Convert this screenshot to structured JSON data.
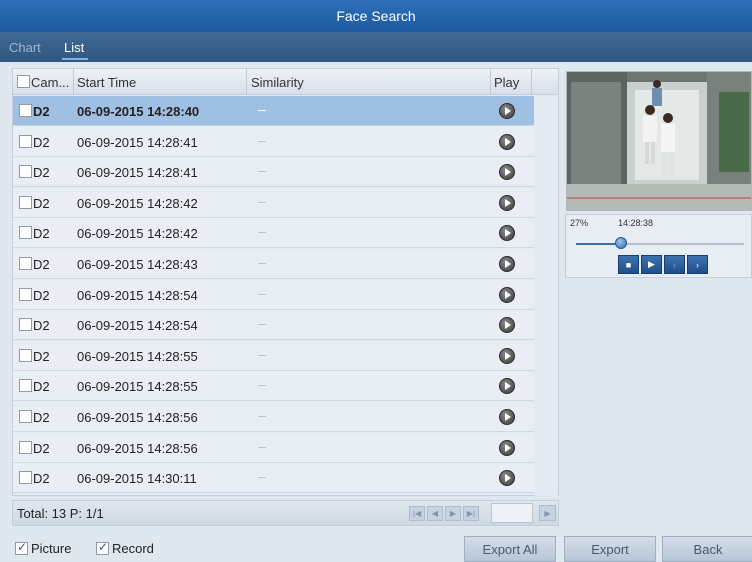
{
  "window": {
    "title": "Face Search"
  },
  "tabs": [
    {
      "label": "Chart",
      "active": false
    },
    {
      "label": "List",
      "active": true
    }
  ],
  "table": {
    "headers": {
      "camera": "Cam...",
      "start_time": "Start Time",
      "similarity": "Similarity",
      "play": "Play"
    },
    "rows": [
      {
        "camera": "D2",
        "start_time": "06-09-2015 14:28:40",
        "similarity": "—",
        "selected": true
      },
      {
        "camera": "D2",
        "start_time": "06-09-2015 14:28:41",
        "similarity": "—"
      },
      {
        "camera": "D2",
        "start_time": "06-09-2015 14:28:41",
        "similarity": "—"
      },
      {
        "camera": "D2",
        "start_time": "06-09-2015 14:28:42",
        "similarity": "—"
      },
      {
        "camera": "D2",
        "start_time": "06-09-2015 14:28:42",
        "similarity": "—"
      },
      {
        "camera": "D2",
        "start_time": "06-09-2015 14:28:43",
        "similarity": "—"
      },
      {
        "camera": "D2",
        "start_time": "06-09-2015 14:28:54",
        "similarity": "—"
      },
      {
        "camera": "D2",
        "start_time": "06-09-2015 14:28:54",
        "similarity": "—"
      },
      {
        "camera": "D2",
        "start_time": "06-09-2015 14:28:55",
        "similarity": "—"
      },
      {
        "camera": "D2",
        "start_time": "06-09-2015 14:28:55",
        "similarity": "—"
      },
      {
        "camera": "D2",
        "start_time": "06-09-2015 14:28:56",
        "similarity": "—"
      },
      {
        "camera": "D2",
        "start_time": "06-09-2015 14:28:56",
        "similarity": "—"
      },
      {
        "camera": "D2",
        "start_time": "06-09-2015 14:30:11",
        "similarity": "—"
      }
    ]
  },
  "footer": {
    "total": "Total: 13  P: 1/1"
  },
  "player": {
    "progress_percent": 27,
    "progress_label": "27%",
    "time": "14:28:38"
  },
  "options": {
    "picture_label": "Picture",
    "picture_checked": true,
    "record_label": "Record",
    "record_checked": true
  },
  "buttons": {
    "export_all": "Export All",
    "export": "Export",
    "back": "Back"
  },
  "colors": {
    "title_bar": "#1e5aa0",
    "selected_row": "#9fc0e2",
    "accent": "#2f6db0"
  }
}
